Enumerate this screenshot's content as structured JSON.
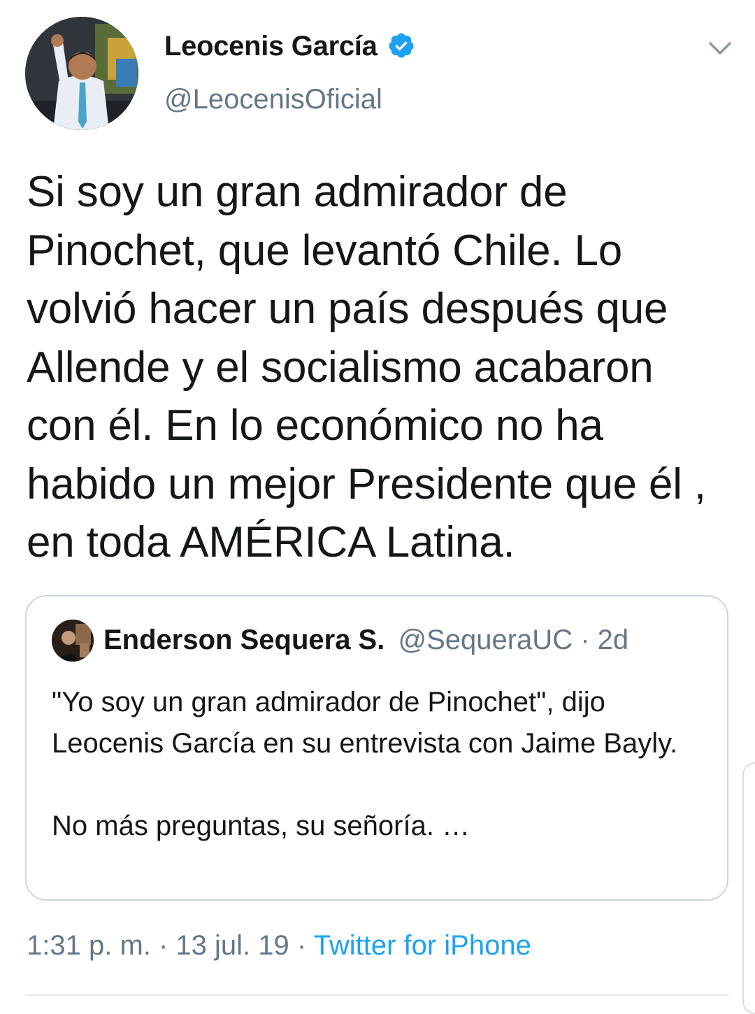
{
  "tweet": {
    "author": {
      "name": "Leocenis García",
      "handle": "@LeocenisOficial",
      "verified": true,
      "avatar": "profile-photo"
    },
    "text": "Si soy un gran admirador de Pinochet, que levantó Chile. Lo volvió hacer un país después que Allende y el socialismo acabaron con él. En lo económico no ha habido un mejor Presidente que él , en toda AMÉRICA Latina.",
    "quoted": {
      "name": "Enderson Sequera S.",
      "handle": "@SequeraUC",
      "separator": "·",
      "time": "2d",
      "text": "\"Yo soy un gran admirador de Pinochet\", dijo Leocenis García en su entrevista con Jaime Bayly.\n\nNo más preguntas, su señoría. …"
    },
    "meta": {
      "time": "1:31 p. m.",
      "sep1": " · ",
      "date": "13 jul. 19",
      "sep2": " · ",
      "source": "Twitter for iPhone"
    }
  },
  "icons": {
    "verified": "verified-badge-icon",
    "menu": "chevron-down-icon"
  },
  "colors": {
    "text": "#14171a",
    "secondary": "#657786",
    "accent": "#1da1f2",
    "border": "#ccd6dd"
  }
}
